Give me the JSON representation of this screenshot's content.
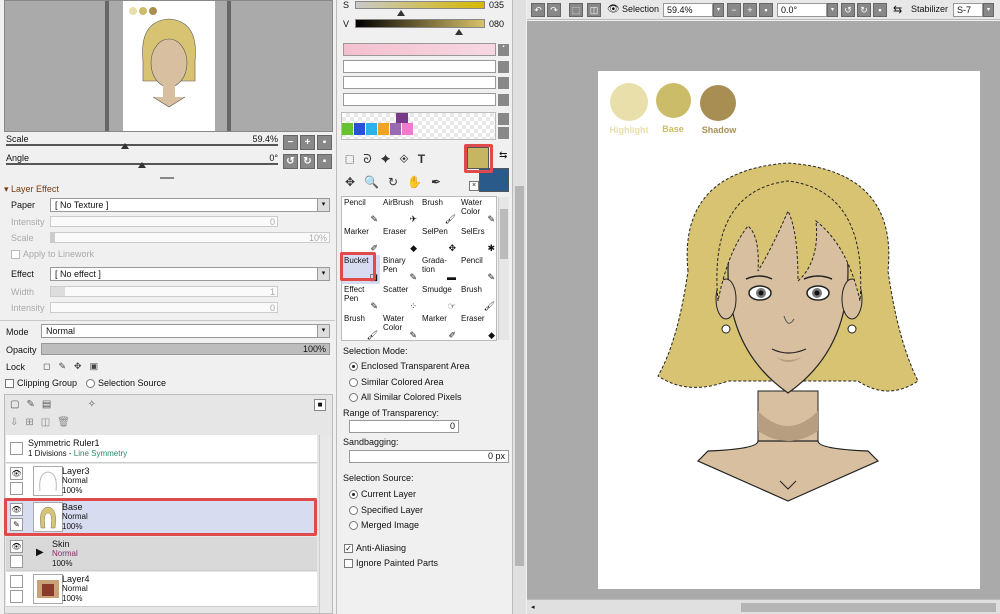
{
  "navigator": {
    "scale_label": "Scale",
    "scale_value": "59.4%",
    "angle_label": "Angle",
    "angle_value": "0°"
  },
  "layer_effect": {
    "header": "Layer Effect",
    "paper_label": "Paper",
    "paper_value": "[ No Texture ]",
    "intensity_label": "Intensity",
    "intensity_value": "0",
    "scale_label": "Scale",
    "scale_value": "10%",
    "apply_linework": "Apply to Linework",
    "effect_label": "Effect",
    "effect_value": "[ No effect ]",
    "width_label": "Width",
    "width_value": "1",
    "intensity2_label": "Intensity",
    "intensity2_value": "0"
  },
  "layer_props": {
    "mode_label": "Mode",
    "mode_value": "Normal",
    "opacity_label": "Opacity",
    "opacity_value": "100%",
    "opacity_fraction": 1.0,
    "lock_label": "Lock",
    "clipping_group": "Clipping Group",
    "selection_source": "Selection Source"
  },
  "layers": [
    {
      "name": "Symmetric Ruler1",
      "line2a": "1 Divisions - ",
      "line2b": "Line Symmetry"
    },
    {
      "name": "Layer3",
      "mode": "Normal",
      "opacity": "100%"
    },
    {
      "name": "Base",
      "mode": "Normal",
      "opacity": "100%"
    },
    {
      "name": "Skin",
      "mode": "Normal",
      "opacity": "100%"
    },
    {
      "name": "Layer4",
      "mode": "Normal",
      "opacity": "100%"
    }
  ],
  "color": {
    "s_label": "S",
    "s_value": "035",
    "v_label": "V",
    "v_value": "080",
    "primary": "#c8b562",
    "secondary": "#2a5a8a",
    "palette": [
      "#66c22e",
      "#2c4fd8",
      "#2bb2e8",
      "#f0a326",
      "#9a6ab0",
      "#f07ad0"
    ]
  },
  "tools": [
    {
      "label": "Pencil",
      "icon": "pencil-icon"
    },
    {
      "label": "AirBrush",
      "icon": "airbrush-icon"
    },
    {
      "label": "Brush",
      "icon": "brush-icon"
    },
    {
      "label": "Water Color",
      "icon": "watercolor-icon"
    },
    {
      "label": "Marker",
      "icon": "marker-icon"
    },
    {
      "label": "Eraser",
      "icon": "eraser-icon"
    },
    {
      "label": "SelPen",
      "icon": "selpen-icon"
    },
    {
      "label": "SelErs",
      "icon": "selers-icon"
    },
    {
      "label": "Bucket",
      "icon": "bucket-icon"
    },
    {
      "label": "Binary Pen",
      "icon": "binary-pen-icon"
    },
    {
      "label": "Grada- tion",
      "icon": "gradation-icon"
    },
    {
      "label": "Pencil",
      "icon": "pencil-icon"
    },
    {
      "label": "Effect Pen",
      "icon": "effect-pen-icon"
    },
    {
      "label": "Scatter",
      "icon": "scatter-icon"
    },
    {
      "label": "Smudge",
      "icon": "smudge-icon"
    },
    {
      "label": "Brush",
      "icon": "brush-icon"
    },
    {
      "label": "Brush",
      "icon": "brush-icon"
    },
    {
      "label": "Water Color",
      "icon": "watercolor-icon"
    },
    {
      "label": "Marker",
      "icon": "marker-icon"
    },
    {
      "label": "Eraser",
      "icon": "eraser-icon"
    }
  ],
  "bucket_options": {
    "selection_mode_label": "Selection Mode:",
    "mode_options": [
      "Enclosed Transparent Area",
      "Similar Colored Area",
      "All Similar Colored Pixels"
    ],
    "range_label": "Range of Transparency:",
    "range_value": "0",
    "sandbagging_label": "Sandbagging:",
    "sandbagging_value": "0 px",
    "selection_source_label": "Selection Source:",
    "source_options": [
      "Current Layer",
      "Specified Layer",
      "Merged Image"
    ],
    "anti_aliasing": "Anti-Aliasing",
    "ignore_painted": "Ignore Painted Parts"
  },
  "toolbar": {
    "selection_label": "Selection",
    "zoom_value": "59.4%",
    "angle_value": "0.0°",
    "stabilizer_label": "Stabilizer",
    "stabilizer_value": "S-7"
  },
  "canvas": {
    "swatches": [
      {
        "label": "Highlight",
        "color": "#e8dfaa",
        "text_color": "#e8dfaa"
      },
      {
        "label": "Base",
        "color": "#cbbc6a",
        "text_color": "#cbbc6a"
      },
      {
        "label": "Shadow",
        "color": "#a98e54",
        "text_color": "#a98e54"
      }
    ],
    "hair_color": "#d8c373",
    "skin_color": "#d7bfa0",
    "shadow_color": "#b79e80"
  }
}
